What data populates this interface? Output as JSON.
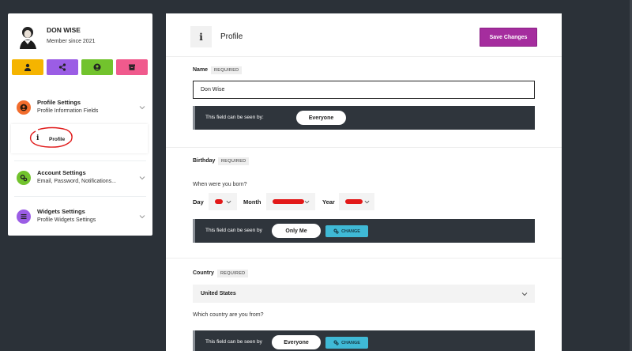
{
  "user": {
    "name": "DON WISE",
    "since": "Member since 2021"
  },
  "sidebar": {
    "quick_actions": [
      {
        "icon": "user-icon",
        "color": "#f5b400"
      },
      {
        "icon": "share-icon",
        "color": "#9b5de5"
      },
      {
        "icon": "account-circle-icon",
        "color": "#72c32d"
      },
      {
        "icon": "archive-icon",
        "color": "#f05a8d"
      }
    ],
    "items": [
      {
        "title": "Profile Settings",
        "subtitle": "Profile Information Fields",
        "icon": "user-circle-icon",
        "color": "#f26d2d"
      },
      {
        "title": "Account Settings",
        "subtitle": "Email, Password, Notifications...",
        "icon": "gears-icon",
        "color": "#72c32d"
      },
      {
        "title": "Widgets Settings",
        "subtitle": "Profile Widgets Settings",
        "icon": "list-icon",
        "color": "#9b5de5"
      }
    ],
    "sub_item": {
      "label": "Profile",
      "icon": "info-icon"
    }
  },
  "header": {
    "title": "Profile",
    "save_label": "Save Changes",
    "accent": "#a52d9e"
  },
  "fields": {
    "required_label": "REQUIRED",
    "name": {
      "label": "Name",
      "value": "Don Wise",
      "visibility_text": "This field can be seen by:",
      "visibility": "Everyone"
    },
    "birthday": {
      "label": "Birthday",
      "question": "When were you born?",
      "day_label": "Day",
      "month_label": "Month",
      "year_label": "Year",
      "visibility_text": "This field can be seen by",
      "visibility": "Only Me",
      "change_label": "CHANGE"
    },
    "country": {
      "label": "Country",
      "value": "United States",
      "question": "Which country are you from?",
      "visibility_text": "This field can be seen by",
      "visibility": "Everyone",
      "change_label": "CHANGE"
    }
  }
}
